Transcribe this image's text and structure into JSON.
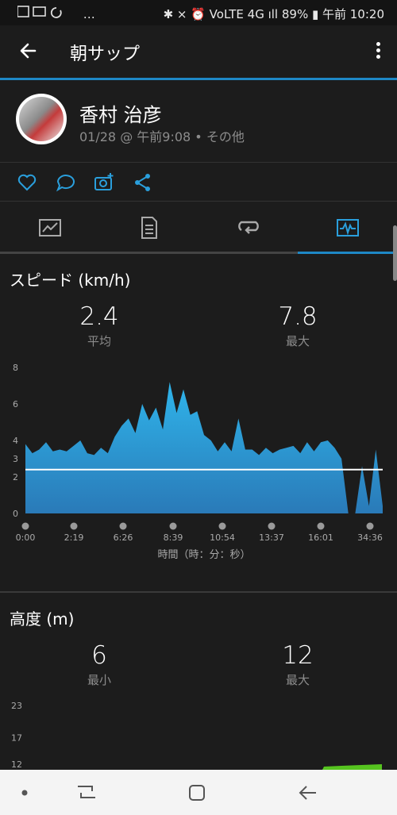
{
  "status_bar": {
    "left_icons": [
      "image-icon",
      "mail-icon",
      "sync-icon",
      "more-notifications-icon"
    ],
    "left_text": "…",
    "right_text": "✱ ⨯ ⏰ VoLTE 4G ıll 89% ▮ 午前 10:20",
    "battery": "89%",
    "time": "午前 10:20"
  },
  "app_bar": {
    "title": "朝サップ"
  },
  "profile": {
    "name": "香村 治彦",
    "meta": "01/28 @ 午前9:08 • その他"
  },
  "actions": [
    "like-icon",
    "comment-icon",
    "add-photo-icon",
    "share-icon"
  ],
  "tabs": [
    {
      "icon": "summary-icon"
    },
    {
      "icon": "details-icon"
    },
    {
      "icon": "laps-icon"
    },
    {
      "icon": "charts-icon",
      "selected": true
    }
  ],
  "speed": {
    "title": "スピード (km/h)",
    "avg": {
      "value": "2.4",
      "label": "平均"
    },
    "max": {
      "value": "7.8",
      "label": "最大"
    },
    "xlabel": "時間（時：分：秒）"
  },
  "elevation": {
    "title": "高度 (m)",
    "min": {
      "value": "6",
      "label": "最小"
    },
    "max": {
      "value": "12",
      "label": "最大"
    }
  },
  "chart_data": [
    {
      "type": "area",
      "title": "スピード (km/h)",
      "xlabel": "時間（時：分：秒）",
      "ylabel": "",
      "ylim": [
        0,
        8
      ],
      "yticks": [
        "0",
        "2",
        "3",
        "4",
        "6",
        "8"
      ],
      "xticks": [
        "0:00",
        "2:19",
        "6:26",
        "8:39",
        "10:54",
        "13:37",
        "16:01",
        "34:36"
      ],
      "average_line": 2.4,
      "fill_color": "#29a7df",
      "series": [
        {
          "values": [
            3.8,
            3.3,
            3.5,
            3.9,
            3.4,
            3.5,
            3.4,
            3.7,
            4.0,
            3.3,
            3.2,
            3.6,
            3.3,
            4.2,
            4.8,
            5.2,
            4.4,
            6.0,
            5.1,
            5.8,
            4.6,
            7.2,
            5.5,
            6.8,
            5.4,
            5.6,
            4.3,
            4.0,
            3.4,
            3.9,
            3.4,
            5.2,
            3.5,
            3.5,
            3.2,
            3.6,
            3.3,
            3.5,
            3.6,
            3.7,
            3.3,
            3.9,
            3.4,
            3.9,
            4.0,
            3.6,
            3.0,
            0.0,
            0.0,
            2.6,
            0.4,
            3.5,
            0.4
          ]
        }
      ]
    },
    {
      "type": "area",
      "title": "高度 (m)",
      "yticks": [
        "23",
        "17",
        "12"
      ],
      "ylim": [
        12,
        23
      ],
      "fill_color": "#56c41f"
    }
  ],
  "nav_bar": [
    "recent-dot-icon",
    "recents-icon",
    "home-icon",
    "back-nav-icon"
  ]
}
